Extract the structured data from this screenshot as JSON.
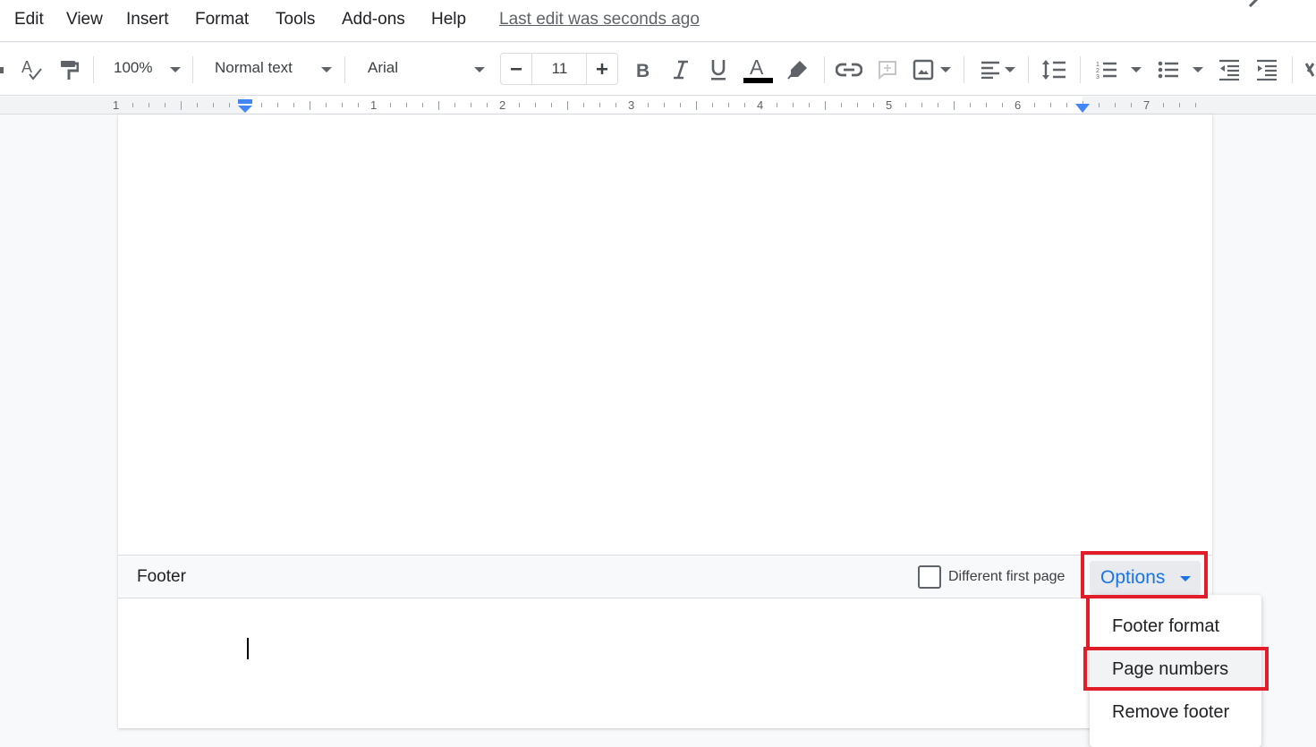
{
  "menubar": {
    "items": [
      "Edit",
      "View",
      "Insert",
      "Format",
      "Tools",
      "Add-ons",
      "Help"
    ],
    "last_edit": "Last edit was seconds ago"
  },
  "toolbar": {
    "zoom": "100%",
    "style": "Normal text",
    "font": "Arial",
    "font_size": "11",
    "text_color": "#000000"
  },
  "ruler": {
    "labels": [
      "1",
      "1",
      "2",
      "3",
      "4",
      "5",
      "6",
      "7"
    ]
  },
  "footer": {
    "label": "Footer",
    "different_first_page_label": "Different first page",
    "different_first_page_checked": false,
    "options_label": "Options",
    "accent_color": "#1a73e8",
    "highlight_color": "#e11d2a"
  },
  "options_menu": {
    "items": [
      "Footer format",
      "Page numbers",
      "Remove footer"
    ],
    "active_index": 1
  }
}
